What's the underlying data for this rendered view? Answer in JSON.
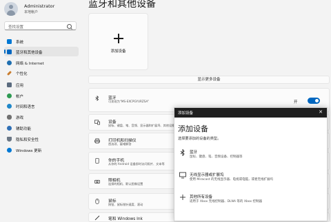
{
  "user": {
    "name": "Administrator",
    "subtitle": "本地帐户"
  },
  "search": {
    "placeholder": "查找设置"
  },
  "sidebar": {
    "items": [
      {
        "label": "系统",
        "icon": "system-icon",
        "color": "#0078d4"
      },
      {
        "label": "蓝牙和其他设备",
        "icon": "bluetooth-devices-icon",
        "color": "#0067c0"
      },
      {
        "label": "网络 & Internet",
        "icon": "network-icon",
        "color": "#1f6fb0"
      },
      {
        "label": "个性化",
        "icon": "brush-icon",
        "color": "#c97d2d"
      },
      {
        "label": "应用",
        "icon": "apps-icon",
        "color": "#5b6b7e"
      },
      {
        "label": "帐户",
        "icon": "account-icon",
        "color": "#2e9a52"
      },
      {
        "label": "时间和语言",
        "icon": "time-language-icon",
        "color": "#1f87c9"
      },
      {
        "label": "游戏",
        "icon": "gaming-icon",
        "color": "#707070"
      },
      {
        "label": "辅助功能",
        "icon": "accessibility-icon",
        "color": "#2f6fb5"
      },
      {
        "label": "隐私和安全性",
        "icon": "shield-icon",
        "color": "#6b7785"
      },
      {
        "label": "Windows 更新",
        "icon": "windows-update-icon",
        "color": "#0078d4"
      }
    ]
  },
  "main": {
    "title": "蓝牙和其他设备",
    "add_device_card": "添加设备",
    "show_more": "显示更多设备",
    "bluetooth": {
      "title": "蓝牙",
      "subtitle": "可发现为“MS-EXCPGYURZSA”",
      "state": "开"
    },
    "rows": [
      {
        "title": "设备",
        "subtitle": "鼠标、键盘、笔、音频、显示器和扩展坞、其他设备",
        "icon": "devices-icon"
      },
      {
        "title": "打印机和扫描仪",
        "subtitle": "首选项、疑难解答",
        "icon": "printer-icon"
      },
      {
        "title": "你的手机",
        "subtitle": "从你的 Android 设备即时访问照片、文本等",
        "icon": "phone-icon"
      },
      {
        "title": "照相机",
        "subtitle": "连接的相机、默认图像设置",
        "icon": "camera-icon"
      },
      {
        "title": "鼠标",
        "subtitle": "按钮、鼠标指针速度、滚动",
        "icon": "mouse-icon"
      },
      {
        "title": "笔和 Windows Ink",
        "subtitle": "",
        "icon": "pen-icon"
      }
    ]
  },
  "dialog": {
    "bar_title": "添加设备",
    "heading": "添加设备",
    "subtitle": "选择要添加的设备的类型。",
    "options": [
      {
        "title": "蓝牙",
        "desc": "鼠标、键盘、笔、音频设备、控制器等",
        "icon": "bluetooth-icon"
      },
      {
        "title": "无线显示器或扩展坞",
        "desc": "使用 Miracast 的无线显示器、电视或电脑，或者无线扩展坞",
        "icon": "monitor-icon"
      },
      {
        "title": "其他所有设备",
        "desc": "适用于 Xbox 无线控制器、DLNA 等的 Xbox 控制器",
        "icon": "plus-icon"
      }
    ]
  }
}
